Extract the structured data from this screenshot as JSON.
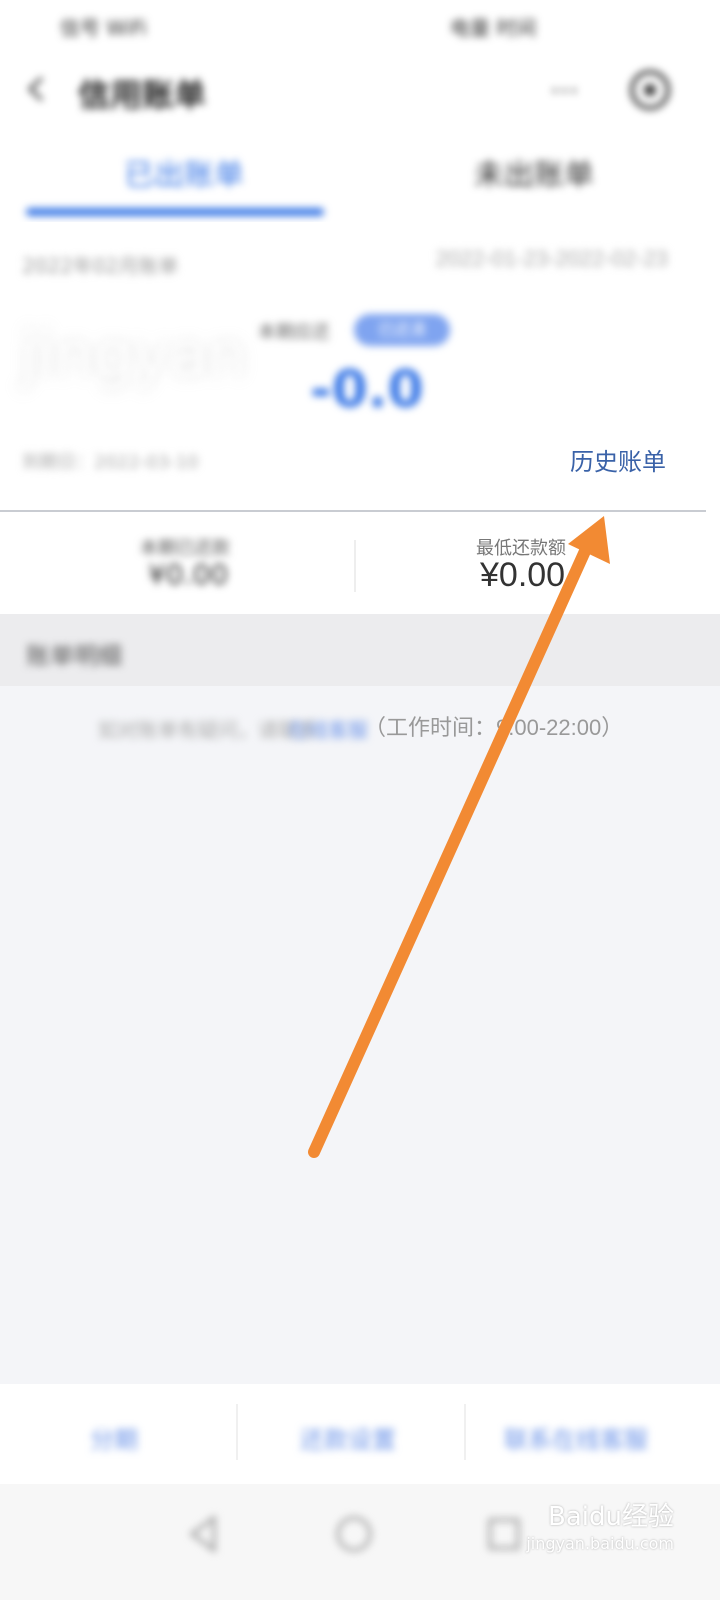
{
  "status_bar": {
    "left": "信号 WiFi",
    "right": "电量 时间"
  },
  "header": {
    "title": "信用账单",
    "more": "···"
  },
  "tabs": [
    {
      "label": "已出账单"
    },
    {
      "label": "未出账单"
    }
  ],
  "bill": {
    "date_label": "2022年02月账单",
    "period": "2022-01-23-2022-02-23",
    "amount_label": "本期应还",
    "pill_label": "已还清",
    "amount": "-0.0",
    "watermark": "jingyan",
    "due_label": "到期日：2022-03-10",
    "history_link": "历史账单"
  },
  "stats": {
    "left_label": "本期已还款",
    "left_value": "¥0.00",
    "right_label": "最低还款额",
    "right_value": "¥0.00"
  },
  "section": {
    "title": "账单明细"
  },
  "service": {
    "prefix": "如对账单有疑问，请联系",
    "link": "在线客服",
    "hours": "（工作时间：9:00-22:00）"
  },
  "bottom_actions": [
    {
      "label": "分期"
    },
    {
      "label": "还款设置"
    },
    {
      "label": "联系在线客服"
    }
  ],
  "watermark": {
    "brand": "Baidu经验",
    "url": "jingyan.baidu.com"
  },
  "colors": {
    "accent": "#3a78e6",
    "link": "#3a62a8",
    "arrow": "#f28a33"
  }
}
